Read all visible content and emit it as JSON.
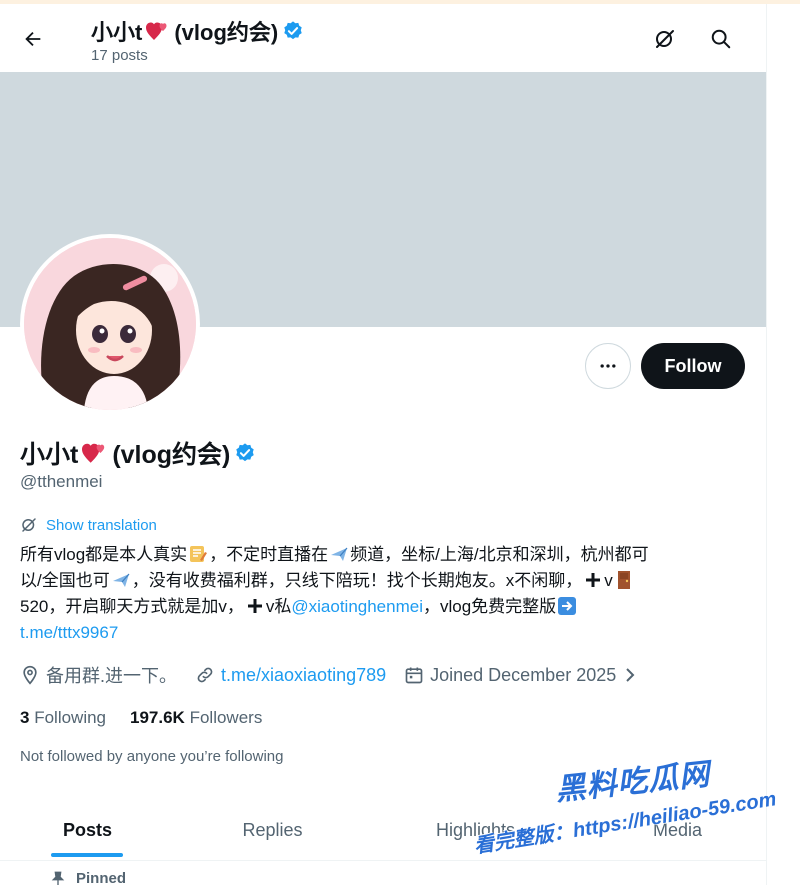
{
  "header": {
    "display_name": "小小t",
    "name_suffix": "(vlog约会)",
    "posts_count": "17 posts"
  },
  "profile": {
    "display_name": "小小t",
    "name_suffix": "(vlog约会)",
    "handle": "@tthenmei",
    "follow_label": "Follow",
    "show_translation": "Show translation",
    "bio": {
      "line1_a": "所有vlog都是本人真实",
      "line1_b": "，不定时直播在",
      "line1_c": "频道，坐标/上海/北京和深圳，杭州都可",
      "line2_a": "以/全国也可",
      "line2_b": "，没有收费福利群，只线下陪玩！找个长期炮友。x不闲聊，",
      "line2_c": "v",
      "line3_a": "520，开启聊天方式就是加v，",
      "line3_b": "v私",
      "line3_mention": "@xiaotinghenmei",
      "line3_c": "，vlog免费完整版",
      "line4_link": "t.me/tttx9967"
    },
    "location": "备用群.进一下。",
    "website": "t.me/xiaoxiaoting789",
    "joined": "Joined December 2025",
    "following_count": "3",
    "following_label": "Following",
    "followers_count": "197.6K",
    "followers_label": "Followers",
    "not_followed": "Not followed by anyone you’re following"
  },
  "tabs": [
    {
      "label": "Posts",
      "active": true
    },
    {
      "label": "Replies",
      "active": false
    },
    {
      "label": "Highlights",
      "active": false
    },
    {
      "label": "Media",
      "active": false
    }
  ],
  "pinned_label": "Pinned",
  "watermark": {
    "title": "黑料吃瓜网",
    "line": "看完整版：https://heiliao-59.com"
  },
  "colors": {
    "accent": "#1d9bf0",
    "verified": "#1d9bf0",
    "banner": "#cfd9de",
    "text_primary": "#0f1419",
    "text_secondary": "#536471"
  }
}
